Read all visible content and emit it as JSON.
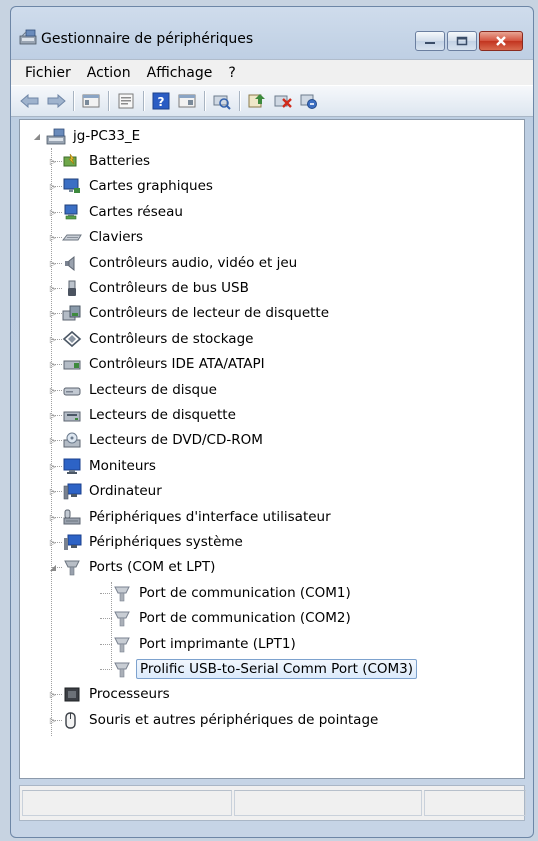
{
  "window": {
    "title": "Gestionnaire de périphériques"
  },
  "menu": [
    "Fichier",
    "Action",
    "Affichage",
    "?"
  ],
  "toolbar": {
    "buttons": [
      "back-icon",
      "forward-icon",
      "sep",
      "properties-icon",
      "sep",
      "view-icon",
      "sep",
      "help-icon",
      "show-hidden-icon",
      "sep",
      "scan-hardware-icon",
      "sep",
      "update-driver-icon",
      "uninstall-icon",
      "disable-icon"
    ]
  },
  "tree": {
    "root": "jg-PC33_E",
    "categories": [
      {
        "label": "Batteries",
        "icon": "battery-icon"
      },
      {
        "label": "Cartes graphiques",
        "icon": "display-adapter-icon"
      },
      {
        "label": "Cartes réseau",
        "icon": "network-adapter-icon"
      },
      {
        "label": "Claviers",
        "icon": "keyboard-icon"
      },
      {
        "label": "Contrôleurs audio, vidéo et jeu",
        "icon": "audio-icon"
      },
      {
        "label": "Contrôleurs de bus USB",
        "icon": "usb-icon"
      },
      {
        "label": "Contrôleurs de lecteur de disquette",
        "icon": "floppy-controller-icon"
      },
      {
        "label": "Contrôleurs de stockage",
        "icon": "storage-controller-icon"
      },
      {
        "label": "Contrôleurs IDE ATA/ATAPI",
        "icon": "ide-controller-icon"
      },
      {
        "label": "Lecteurs de disque",
        "icon": "disk-drive-icon"
      },
      {
        "label": "Lecteurs de disquette",
        "icon": "floppy-drive-icon"
      },
      {
        "label": "Lecteurs de DVD/CD-ROM",
        "icon": "dvd-drive-icon"
      },
      {
        "label": "Moniteurs",
        "icon": "monitor-icon"
      },
      {
        "label": "Ordinateur",
        "icon": "computer-icon"
      },
      {
        "label": "Périphériques d'interface utilisateur",
        "icon": "hid-icon"
      },
      {
        "label": "Périphériques système",
        "icon": "system-devices-icon"
      },
      {
        "label": "Ports (COM et LPT)",
        "icon": "port-icon",
        "expanded": true,
        "children": [
          "Port de communication (COM1)",
          "Port de communication (COM2)",
          "Port imprimante (LPT1)",
          "Prolific USB-to-Serial Comm Port (COM3)"
        ],
        "selected_child": 3
      },
      {
        "label": "Processeurs",
        "icon": "processor-icon"
      },
      {
        "label": "Souris et autres périphériques de pointage",
        "icon": "mouse-icon"
      }
    ]
  },
  "colors": {
    "titlebar": "#c6d4e6",
    "close_button": "#c2341f",
    "selection_border": "#7da2ce"
  }
}
